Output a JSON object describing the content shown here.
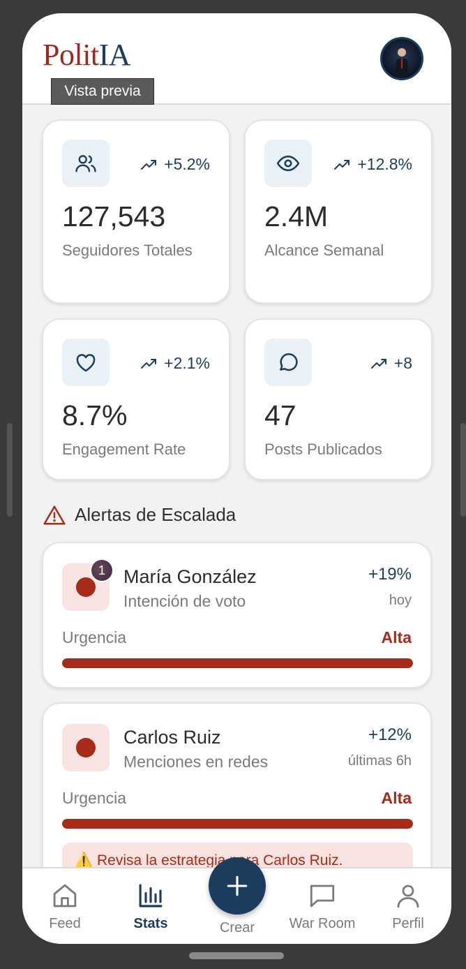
{
  "app": {
    "logo_part1": "Polit",
    "logo_part2": "IA",
    "tooltip": "Vista previa",
    "brand_red": "#9b2a20",
    "brand_navy": "#1d3d5e"
  },
  "stats": [
    {
      "icon": "users-icon",
      "trend": "+5.2%",
      "value": "127,543",
      "label": "Seguidores Totales"
    },
    {
      "icon": "eye-icon",
      "trend": "+12.8%",
      "value": "2.4M",
      "label": "Alcance Semanal"
    },
    {
      "icon": "heart-icon",
      "trend": "+2.1%",
      "value": "8.7%",
      "label": "Engagement Rate"
    },
    {
      "icon": "message-icon",
      "trend": "+8",
      "value": "47",
      "label": "Posts Publicados"
    }
  ],
  "alerts": {
    "title": "Alertas de Escalada",
    "items": [
      {
        "name": "María González",
        "metric": "Intención de voto",
        "change": "+19%",
        "time": "hoy",
        "urgency_label": "Urgencia",
        "urgency": "Alta",
        "badge": "1",
        "urgency_level": 1.0
      },
      {
        "name": "Carlos Ruiz",
        "metric": "Menciones en redes",
        "change": "+12%",
        "time": "últimas 6h",
        "urgency_label": "Urgencia",
        "urgency": "Alta",
        "warning": "⚠️ Revisa la estrategia para Carlos Ruiz.",
        "urgency_level": 1.0
      }
    ]
  },
  "nav": {
    "feed": "Feed",
    "stats": "Stats",
    "create": "Crear",
    "war_room": "War Room",
    "profile": "Perfil",
    "active": "stats"
  }
}
